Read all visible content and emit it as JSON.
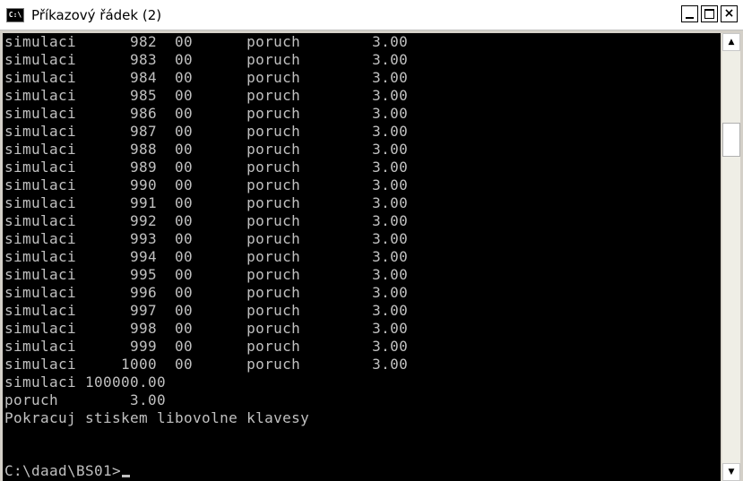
{
  "window": {
    "title": "Příkazový řádek (2)",
    "icon_label": "C:\\",
    "controls": {
      "minimize": "minimize",
      "maximize": "maximize",
      "close": "×"
    }
  },
  "console": {
    "lines": [
      "simulaci      982  00      poruch        3.00",
      "simulaci      983  00      poruch        3.00",
      "simulaci      984  00      poruch        3.00",
      "simulaci      985  00      poruch        3.00",
      "simulaci      986  00      poruch        3.00",
      "simulaci      987  00      poruch        3.00",
      "simulaci      988  00      poruch        3.00",
      "simulaci      989  00      poruch        3.00",
      "simulaci      990  00      poruch        3.00",
      "simulaci      991  00      poruch        3.00",
      "simulaci      992  00      poruch        3.00",
      "simulaci      993  00      poruch        3.00",
      "simulaci      994  00      poruch        3.00",
      "simulaci      995  00      poruch        3.00",
      "simulaci      996  00      poruch        3.00",
      "simulaci      997  00      poruch        3.00",
      "simulaci      998  00      poruch        3.00",
      "simulaci      999  00      poruch        3.00",
      "simulaci     1000  00      poruch        3.00",
      "simulaci 100000.00",
      "poruch        3.00",
      "Pokracuj stiskem libovolne klavesy"
    ],
    "prompt": "C:\\daad\\BS01>"
  },
  "colors": {
    "console_bg": "#000000",
    "console_text": "#c0c0c0",
    "titlebar_bg": "#ffffff"
  },
  "scrollbar": {
    "up_arrow_icon": "▲",
    "down_arrow_icon": "▼"
  }
}
